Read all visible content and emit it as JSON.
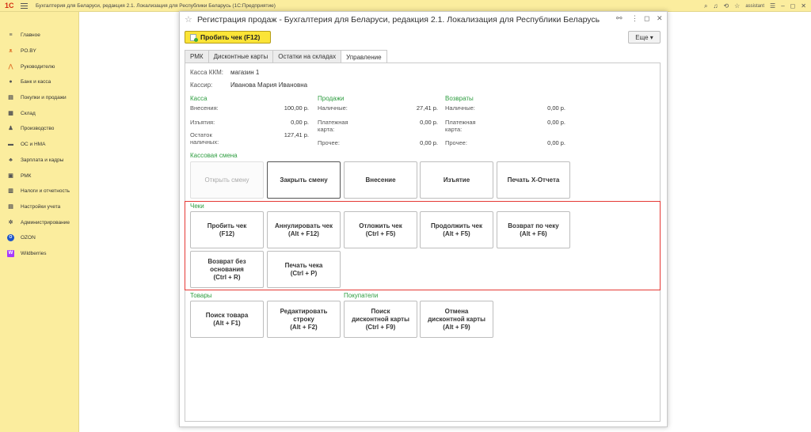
{
  "topbar": {
    "logo": "1С",
    "app_title": "Бухгалтерия для Беларуси, редакция 2.1. Локализация для Республики Беларусь  (1С:Предприятие)",
    "user": "assistant"
  },
  "sidebar": {
    "items": [
      {
        "label": "Главное",
        "icon": "menu-icon"
      },
      {
        "label": "PO.BY",
        "icon": "po-by-icon"
      },
      {
        "label": "Руководителю",
        "icon": "chart-icon"
      },
      {
        "label": "Банк и касса",
        "icon": "bank-icon"
      },
      {
        "label": "Покупки и продажи",
        "icon": "cart-icon"
      },
      {
        "label": "Склад",
        "icon": "warehouse-icon"
      },
      {
        "label": "Производство",
        "icon": "production-icon"
      },
      {
        "label": "ОС и НМА",
        "icon": "assets-icon"
      },
      {
        "label": "Зарплата и кадры",
        "icon": "salary-icon"
      },
      {
        "label": "РМК",
        "icon": "pos-icon"
      },
      {
        "label": "Налоги и отчетность",
        "icon": "taxes-icon"
      },
      {
        "label": "Настройки учета",
        "icon": "settings-icon"
      },
      {
        "label": "Администрирование",
        "icon": "gear-icon"
      },
      {
        "label": "OZON",
        "icon": "ozon-icon"
      },
      {
        "label": "Wildberries",
        "icon": "wildberries-icon"
      }
    ]
  },
  "window": {
    "title": "Регистрация продаж - Бухгалтерия для Беларуси, редакция 2.1. Локализация для Республики Беларусь",
    "primary_button": "Пробить чек (F12)",
    "more_button": "Еще ▾",
    "tabs": [
      "РМК",
      "Дисконтные карты",
      "Остатки на складах",
      "Управление"
    ],
    "active_tab": "Управление"
  },
  "info": {
    "kkm_label": "Касса ККМ:",
    "kkm_value": "магазин 1",
    "cashier_label": "Кассир:",
    "cashier_value": "Иванова Мария Ивановна"
  },
  "kassa": {
    "title": "Касса",
    "rows": [
      {
        "label": "Внесения:",
        "value": "100,00 р."
      },
      {
        "label": "Изъятия:",
        "value": "0,00 р."
      },
      {
        "label": "Остаток\nналичных:",
        "value": "127,41 р."
      }
    ]
  },
  "prodazhi": {
    "title": "Продажи",
    "rows": [
      {
        "label": "Наличные:",
        "value": "27,41 р."
      },
      {
        "label": "Платежная\nкарта:",
        "value": "0,00 р."
      },
      {
        "label": "Прочее:",
        "value": "0,00 р."
      }
    ]
  },
  "vozvraty": {
    "title": "Возвраты",
    "rows": [
      {
        "label": "Наличные:",
        "value": "0,00 р."
      },
      {
        "label": "Платежная\nкарта:",
        "value": "0,00 р."
      },
      {
        "label": "Прочее:",
        "value": "0,00 р."
      }
    ]
  },
  "shift": {
    "title": "Кассовая смена",
    "buttons": [
      "Открыть смену",
      "Закрыть смену",
      "Внесение",
      "Изъятие",
      "Печать X-Отчета"
    ]
  },
  "cheki": {
    "title": "Чеки",
    "buttons": [
      "Пробить чек\n(F12)",
      "Аннулировать чек\n(Alt + F12)",
      "Отложить чек\n(Ctrl + F5)",
      "Продолжить чек\n(Alt + F5)",
      "Возврат по чеку\n(Alt + F6)",
      "Возврат без\nоснования\n(Ctrl + R)",
      "Печать чека\n(Ctrl + P)"
    ]
  },
  "tovary": {
    "title": "Товары",
    "buttons": [
      "Поиск товара\n(Alt + F1)",
      "Редактировать\nстроку\n(Alt + F2)"
    ]
  },
  "pokupateli": {
    "title": "Покупатели",
    "buttons": [
      "Поиск\nдисконтной карты\n(Ctrl + F9)",
      "Отмена\nдисконтной карты\n(Alt + F9)"
    ]
  },
  "colors": {
    "panel_bg": "#fbed9e",
    "primary_button": "#fbe437",
    "section_title": "#2e9d40",
    "highlight": "#e53935"
  }
}
